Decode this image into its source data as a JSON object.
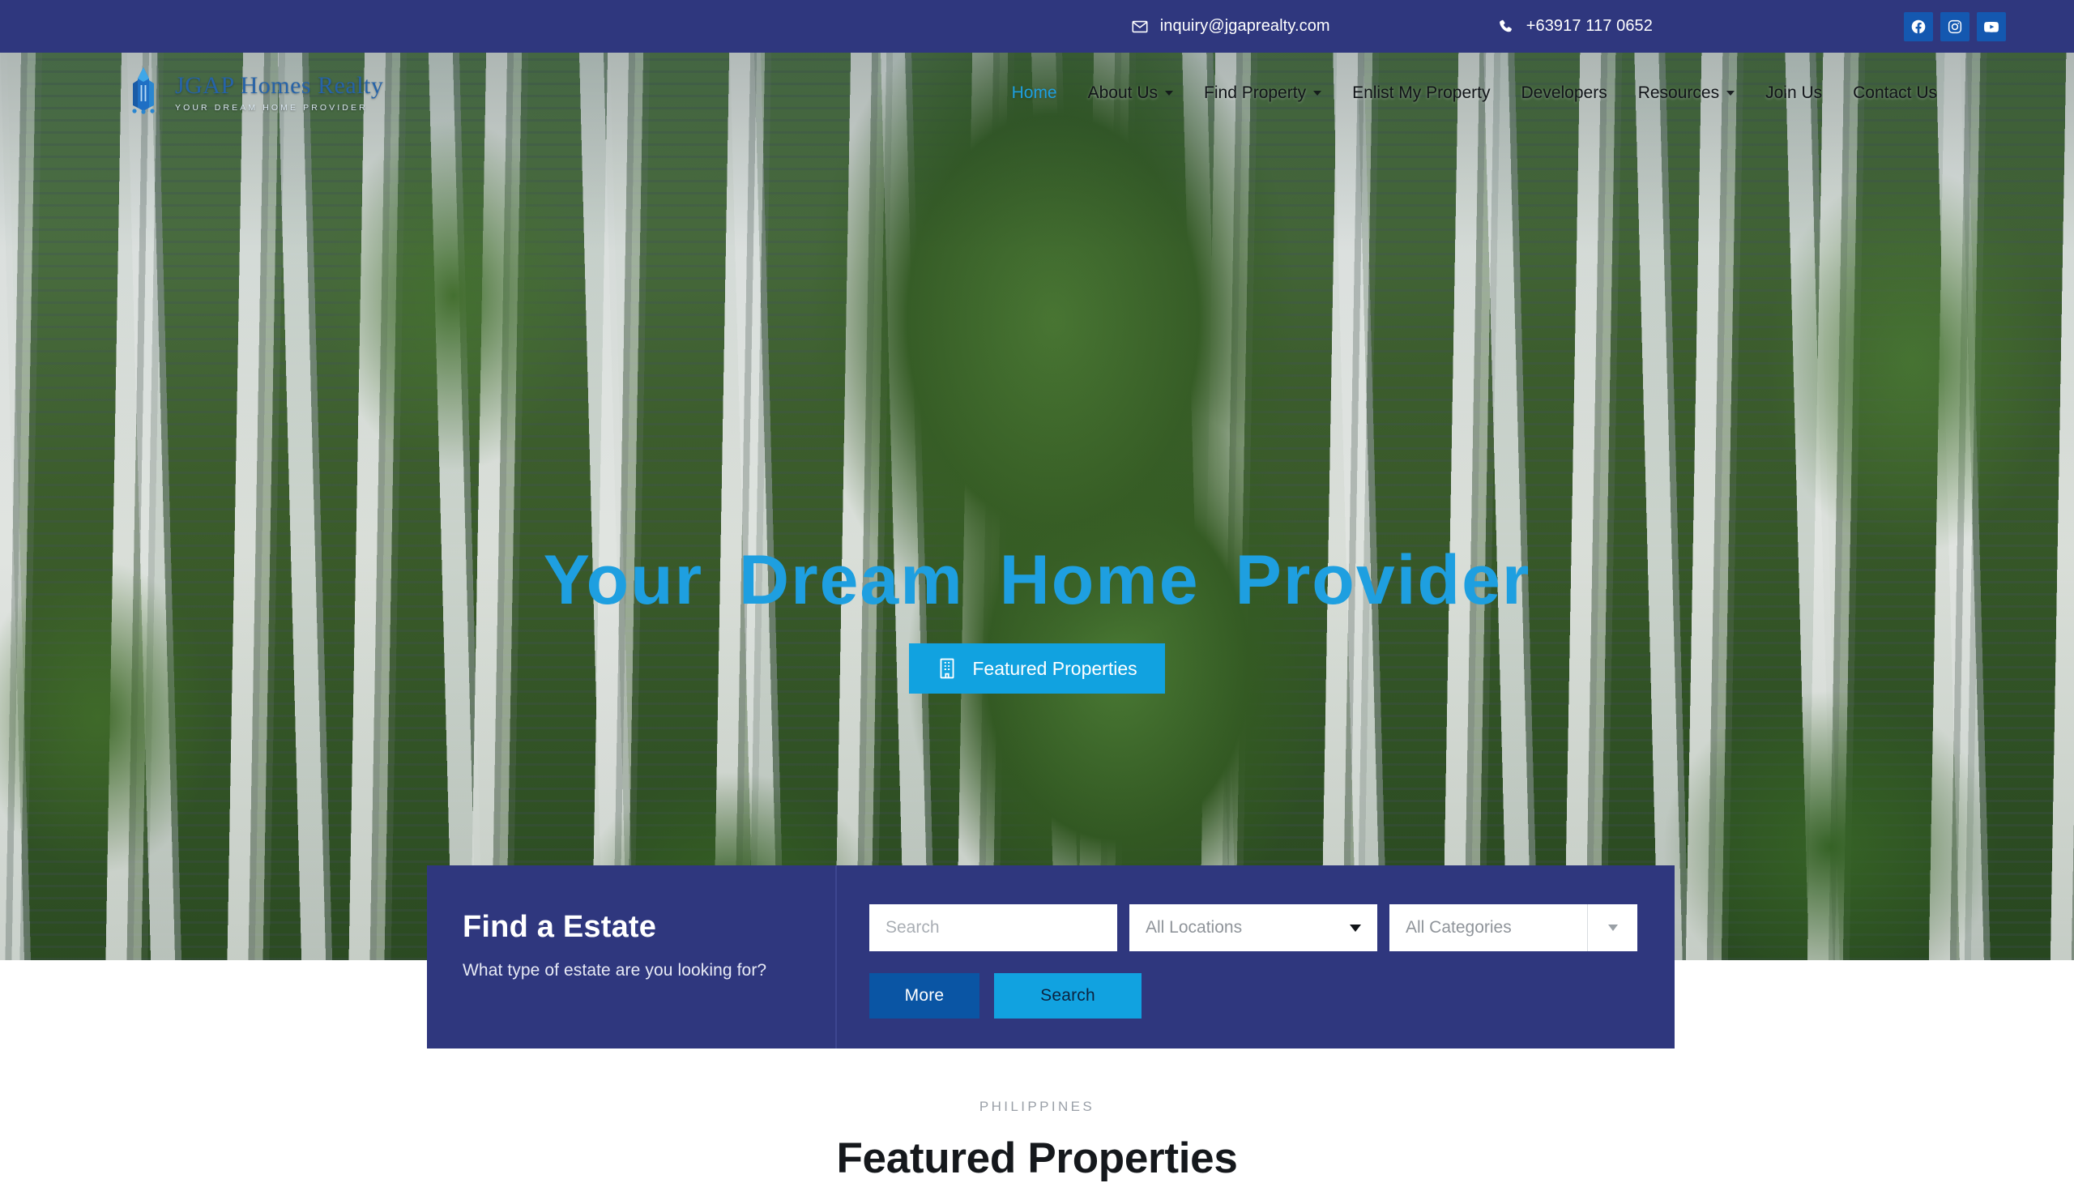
{
  "topbar": {
    "email": "inquiry@jgaprealty.com",
    "phone": "+63917 117 0652",
    "email_icon": "envelope-icon",
    "phone_icon": "phone-icon",
    "socials": [
      {
        "name": "facebook",
        "label": "Facebook"
      },
      {
        "name": "instagram",
        "label": "Instagram"
      },
      {
        "name": "youtube",
        "label": "YouTube"
      }
    ],
    "bg_color": "#2F377E",
    "social_bg_color": "#1458B0"
  },
  "brand": {
    "title": "JGAP Homes Realty",
    "tagline": "YOUR DREAM HOME PROVIDER",
    "logo_icon": "jgap-building-logo-icon",
    "title_color": "#2663a8"
  },
  "nav": {
    "items": [
      {
        "label": "Home",
        "active": true,
        "caret": false
      },
      {
        "label": "About Us",
        "active": false,
        "caret": true
      },
      {
        "label": "Find Property",
        "active": false,
        "caret": true
      },
      {
        "label": "Enlist My Property",
        "active": false,
        "caret": false
      },
      {
        "label": "Developers",
        "active": false,
        "caret": false
      },
      {
        "label": "Resources",
        "active": false,
        "caret": true
      },
      {
        "label": "Join Us",
        "active": false,
        "caret": false
      },
      {
        "label": "Contact Us",
        "active": false,
        "caret": false
      }
    ],
    "active_color": "#1E9FE0"
  },
  "hero": {
    "title": "Your Dream Home Provider",
    "title_color": "#1E9FE0",
    "cta_label": "Featured Properties",
    "cta_icon": "building-icon",
    "cta_color": "#11A2E0",
    "background_image": "aerial-cityscape-highrise-towers-with-green-parks"
  },
  "search": {
    "heading": "Find a Estate",
    "subheading": "What type of estate are you looking for?",
    "search_value": "",
    "search_placeholder": "Search",
    "location_value": "All Locations",
    "category_value": "All Categories",
    "more_label": "More",
    "search_label": "Search",
    "panel_color": "#2F377E",
    "more_color": "#0A55A4",
    "search_button_color": "#11A2E0"
  },
  "featured": {
    "eyebrow": "PHILIPPINES",
    "title": "Featured Properties"
  }
}
